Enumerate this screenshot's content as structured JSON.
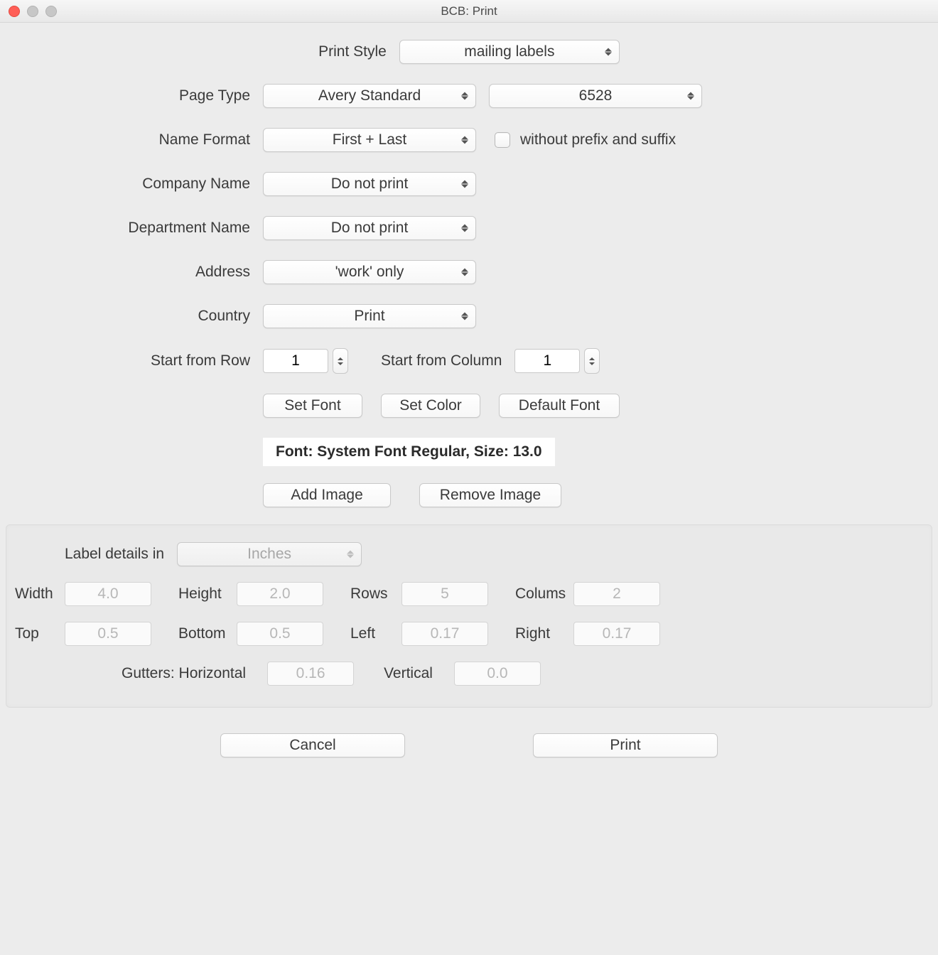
{
  "window": {
    "title": "BCB: Print"
  },
  "labels": {
    "print_style": "Print Style",
    "page_type": "Page Type",
    "name_format": "Name Format",
    "without_affix": "without prefix and suffix",
    "company_name": "Company Name",
    "department_name": "Department Name",
    "address": "Address",
    "country": "Country",
    "start_row": "Start from Row",
    "start_col": "Start from Column",
    "set_font": "Set Font",
    "set_color": "Set Color",
    "default_font": "Default Font",
    "add_image": "Add Image",
    "remove_image": "Remove Image",
    "label_details_in": "Label details in",
    "width": "Width",
    "height": "Height",
    "rows": "Rows",
    "colums": "Colums",
    "top": "Top",
    "bottom": "Bottom",
    "left": "Left",
    "right": "Right",
    "gutters_h": "Gutters: Horizontal",
    "vertical": "Vertical",
    "cancel": "Cancel",
    "print": "Print"
  },
  "selects": {
    "print_style": "mailing labels",
    "page_type_vendor": "Avery Standard",
    "page_type_number": "6528",
    "name_format": "First + Last",
    "company_name": "Do not print",
    "department_name": "Do not print",
    "address": "'work' only",
    "country": "Print",
    "units": "Inches"
  },
  "steppers": {
    "start_row": "1",
    "start_col": "1"
  },
  "font_display": "Font: System Font Regular, Size: 13.0",
  "details": {
    "width": "4.0",
    "height": "2.0",
    "rows": "5",
    "colums": "2",
    "top": "0.5",
    "bottom": "0.5",
    "left": "0.17",
    "right": "0.17",
    "gutter_h": "0.16",
    "gutter_v": "0.0"
  }
}
